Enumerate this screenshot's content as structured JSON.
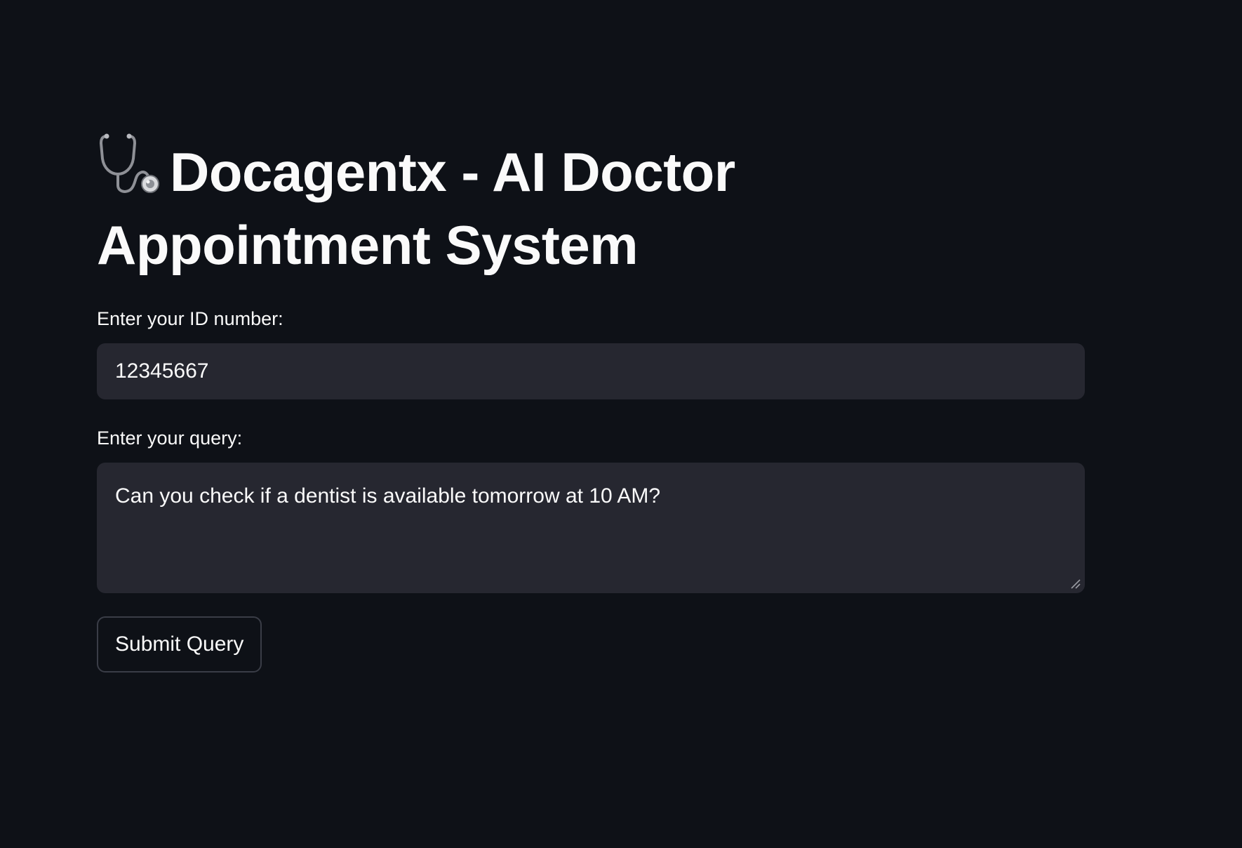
{
  "app": {
    "title_icon": "stethoscope-icon",
    "title": "Docagentx - AI Doctor Appointment System"
  },
  "form": {
    "id_label": "Enter your ID number:",
    "id_value": "12345667",
    "query_label": "Enter your query:",
    "query_value": "Can you check if a dentist is available tomorrow at 10 AM?",
    "submit_label": "Submit Query"
  },
  "colors": {
    "background": "#0e1117",
    "input_background": "#262730",
    "text": "#fafafa",
    "button_border": "#3a3d47"
  }
}
